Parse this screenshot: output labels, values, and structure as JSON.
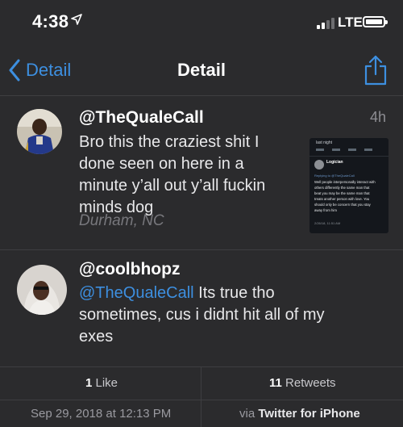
{
  "status_bar": {
    "time": "4:38",
    "carrier": "LTE",
    "icons": [
      "location-arrow-icon",
      "signal-bars-icon",
      "battery-icon"
    ]
  },
  "nav": {
    "back_label": "Detail",
    "title": "Detail",
    "share_icon": "share-icon",
    "accent_color": "#3d8fe0"
  },
  "tweets": [
    {
      "handle": "@TheQualeCall",
      "time_ago": "4h",
      "text_lines": [
        "Bro this the craziest shit I",
        "done seen on here in a",
        "minute y’all out y’all fuckin",
        "minds dog"
      ],
      "location": "Durham, NC",
      "media": {
        "header": "last night",
        "name": "Logician",
        "reply": "Replying to @TheQualeCall",
        "lines": [
          "Well people interpersonally interact with",
          "others differently the same man that",
          "beat you may be the same man that",
          "treats another person with love. You",
          "should only be concern that you stay",
          "away from him"
        ],
        "date": "2/26/18, 11:51 AM"
      }
    },
    {
      "handle": "@coolbhopz",
      "mention": "@TheQualeCall",
      "text_first": " Its true tho",
      "text_lines": [
        "sometimes, cus i didnt hit all of my",
        "exes"
      ]
    }
  ],
  "stats": {
    "likes_count": "1",
    "likes_label": " Like",
    "retweets_count": "11",
    "retweets_label": " Retweets"
  },
  "meta": {
    "date": "Sep 29, 2018 at 12:13 PM",
    "via_prefix": "via ",
    "via_app": "Twitter for iPhone"
  }
}
